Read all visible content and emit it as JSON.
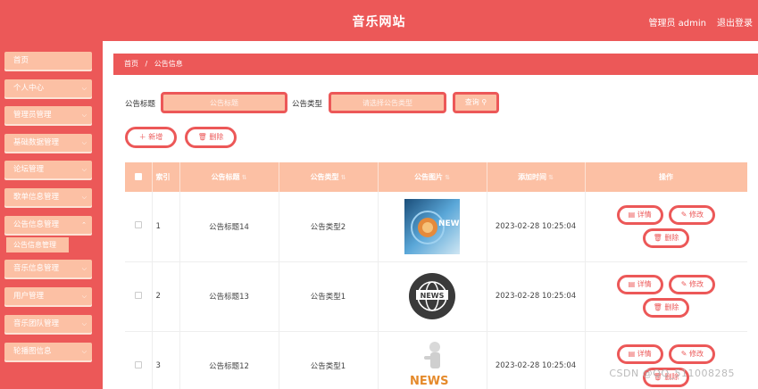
{
  "header": {
    "title": "音乐网站",
    "user": "管理员 admin",
    "logout": "退出登录"
  },
  "sidebar": {
    "items": [
      {
        "label": "首页",
        "chevron": false
      },
      {
        "label": "个人中心",
        "chevron": true
      },
      {
        "label": "管理员管理",
        "chevron": true
      },
      {
        "label": "基础数据管理",
        "chevron": true
      },
      {
        "label": "论坛管理",
        "chevron": true
      },
      {
        "label": "歌单信息管理",
        "chevron": true
      },
      {
        "label": "公告信息管理",
        "chevron": true
      },
      {
        "label": "音乐信息管理",
        "chevron": true
      },
      {
        "label": "用户管理",
        "chevron": true
      },
      {
        "label": "音乐团队管理",
        "chevron": true
      },
      {
        "label": "轮播图信息",
        "chevron": true
      }
    ],
    "sub_active": "公告信息管理"
  },
  "breadcrumb": {
    "home": "首页",
    "separator": "/",
    "current": "公告信息"
  },
  "search": {
    "title_label": "公告标题",
    "title_placeholder": "公告标题",
    "type_label": "公告类型",
    "type_placeholder": "请选择公告类型",
    "query_button": "查询",
    "query_icon": "search-icon"
  },
  "actions": {
    "add": "新增",
    "add_icon": "plus-icon",
    "delete": "删除",
    "delete_icon": "trash-icon"
  },
  "table": {
    "headers": [
      "索引",
      "公告标题",
      "公告类型",
      "公告图片",
      "添加时间",
      "操作"
    ],
    "rows": [
      {
        "index": "1",
        "title": "公告标题14",
        "type": "公告类型2",
        "image": "news-abstract-image",
        "time": "2023-02-28 10:25:04"
      },
      {
        "index": "2",
        "title": "公告标题13",
        "type": "公告类型1",
        "image": "news-globe-image",
        "time": "2023-02-28 10:25:04"
      },
      {
        "index": "3",
        "title": "公告标题12",
        "type": "公告类型1",
        "image": "news-figure-image",
        "time": "2023-02-28 10:25:04"
      }
    ],
    "op_labels": {
      "detail": "详情",
      "edit": "修改",
      "delete": "删除"
    },
    "news_word": "NEWS"
  },
  "watermark": "CSDN @QQ_511008285",
  "colors": {
    "primary": "#ec5858",
    "light": "#fcc0a4"
  }
}
